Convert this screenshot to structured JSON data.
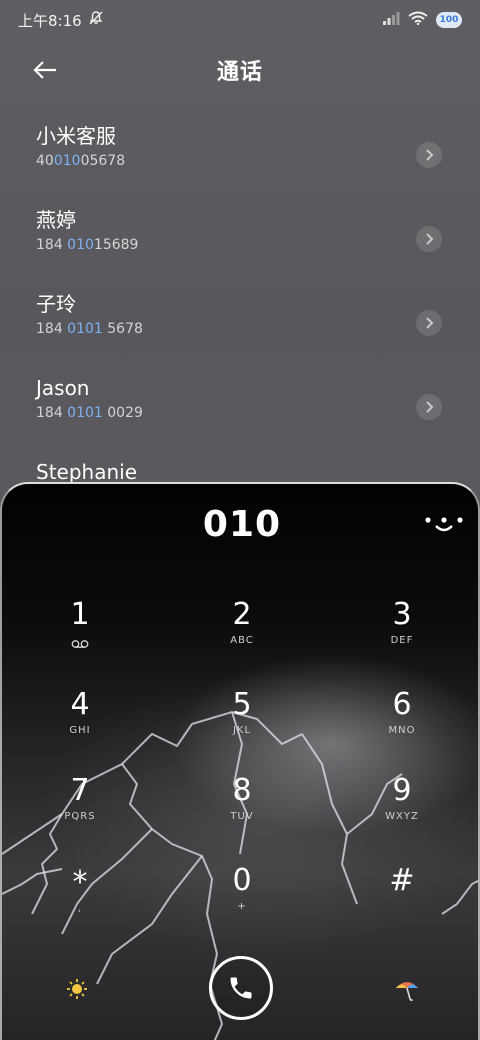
{
  "status_bar": {
    "time": "上午8:16",
    "battery": "100"
  },
  "header": {
    "title": "通话"
  },
  "contacts": [
    {
      "name": "小米客服",
      "number_pre": "40",
      "number_hl": "010",
      "number_post": "05678"
    },
    {
      "name": "燕婷",
      "number_pre": "184 ",
      "number_hl": "010",
      "number_post": "15689"
    },
    {
      "name": "子玲",
      "number_pre": "184 ",
      "number_hl": "0101",
      "number_post": " 5678"
    },
    {
      "name": "Jason",
      "number_pre": "184 ",
      "number_hl": "0101",
      "number_post": " 0029"
    },
    {
      "name": "Stephanie",
      "number_pre": "",
      "number_hl": "",
      "number_post": ""
    }
  ],
  "dialpad": {
    "entered": "010",
    "keys": [
      {
        "digit": "1",
        "letters": ""
      },
      {
        "digit": "2",
        "letters": "ABC"
      },
      {
        "digit": "3",
        "letters": "DEF"
      },
      {
        "digit": "4",
        "letters": "GHI"
      },
      {
        "digit": "5",
        "letters": "JKL"
      },
      {
        "digit": "6",
        "letters": "MNO"
      },
      {
        "digit": "7",
        "letters": "PQRS"
      },
      {
        "digit": "8",
        "letters": "TUV"
      },
      {
        "digit": "9",
        "letters": "WXYZ"
      },
      {
        "digit": "*",
        "letters": ","
      },
      {
        "digit": "0",
        "letters": "+"
      },
      {
        "digit": "#",
        "letters": ""
      }
    ]
  },
  "icons": {
    "voicemail": "voicemail-icon",
    "call": "phone-icon",
    "left_action": "sun-icon",
    "right_action": "umbrella-icon",
    "more": "more-icon"
  }
}
